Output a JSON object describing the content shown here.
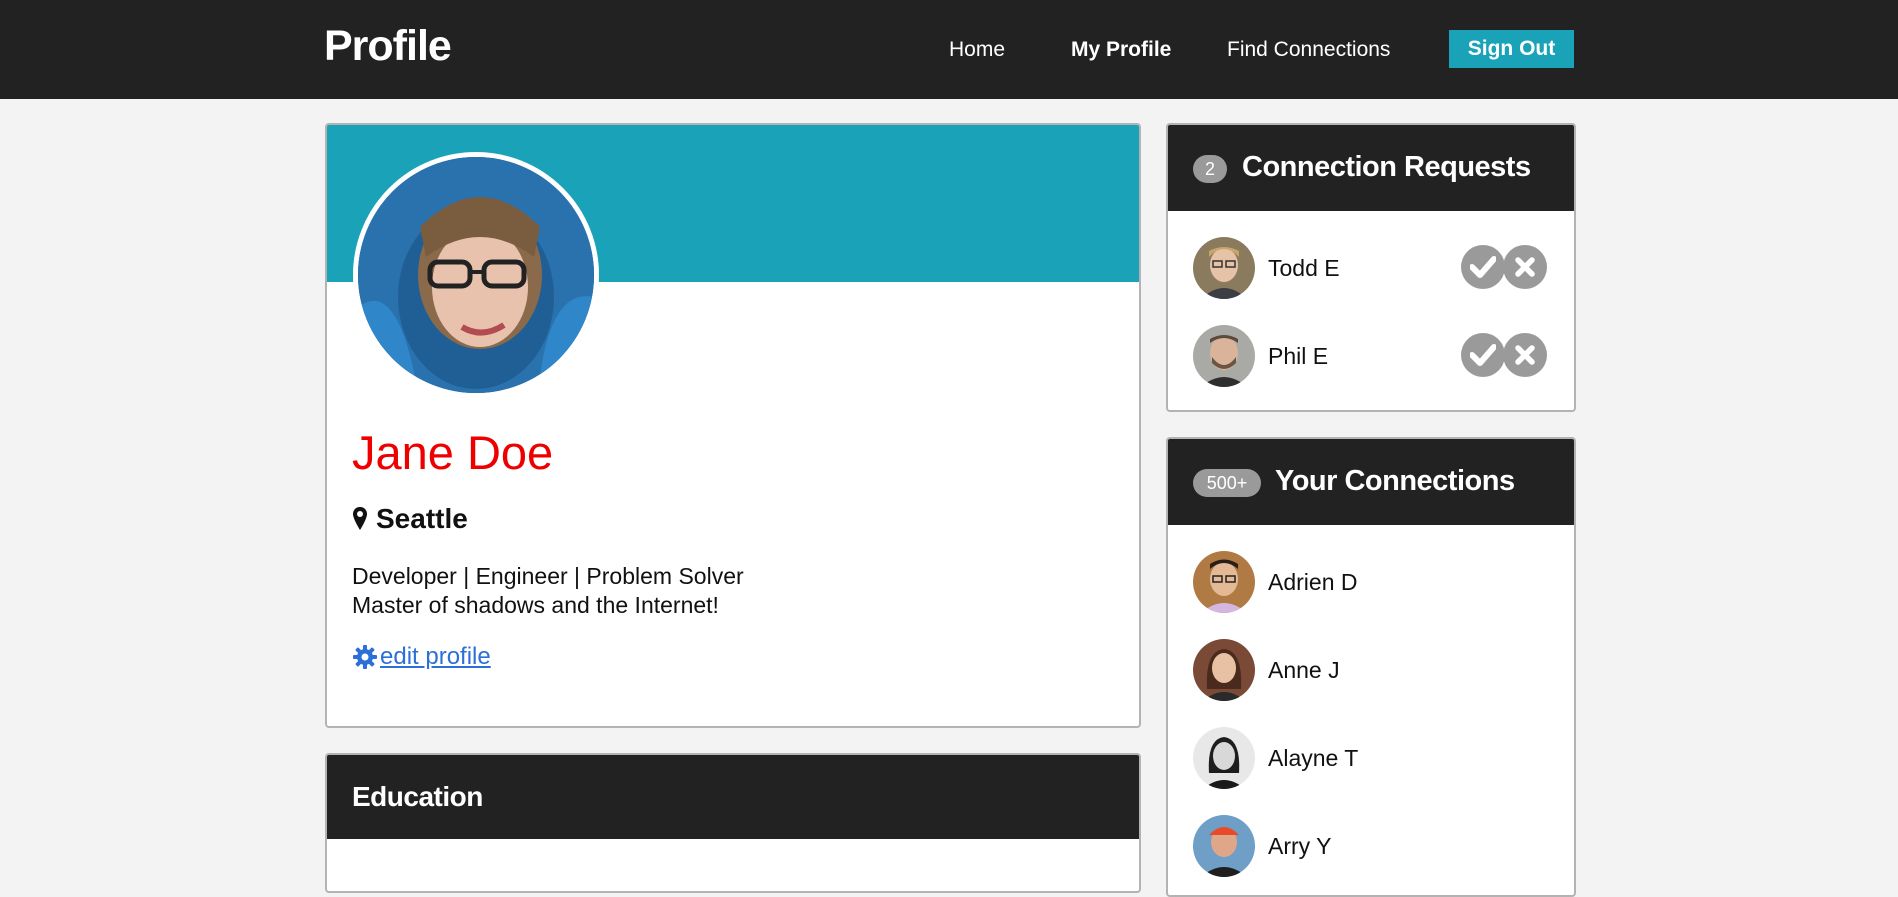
{
  "nav": {
    "brand": "Profile",
    "links": [
      "Home",
      "My Profile",
      "Find Connections"
    ],
    "signout": "Sign Out"
  },
  "profile": {
    "name": "Jane Doe",
    "location": "Seattle",
    "bio_line1": "Developer | Engineer | Problem Solver",
    "bio_line2": "Master of shadows and the Internet!",
    "edit_label": " edit profile"
  },
  "education": {
    "title": "Education"
  },
  "requests": {
    "count": "2",
    "title": "Connection Requests",
    "people": [
      "Todd E",
      "Phil E"
    ]
  },
  "connections": {
    "count": "500+",
    "title": "Your Connections",
    "people": [
      "Adrien D",
      "Anne J",
      "Alayne T",
      "Arry Y"
    ]
  },
  "colors": {
    "accent": "#1aa3b8",
    "name_color": "#ee0000",
    "link": "#2c6fd8",
    "header_bg": "#222222"
  }
}
